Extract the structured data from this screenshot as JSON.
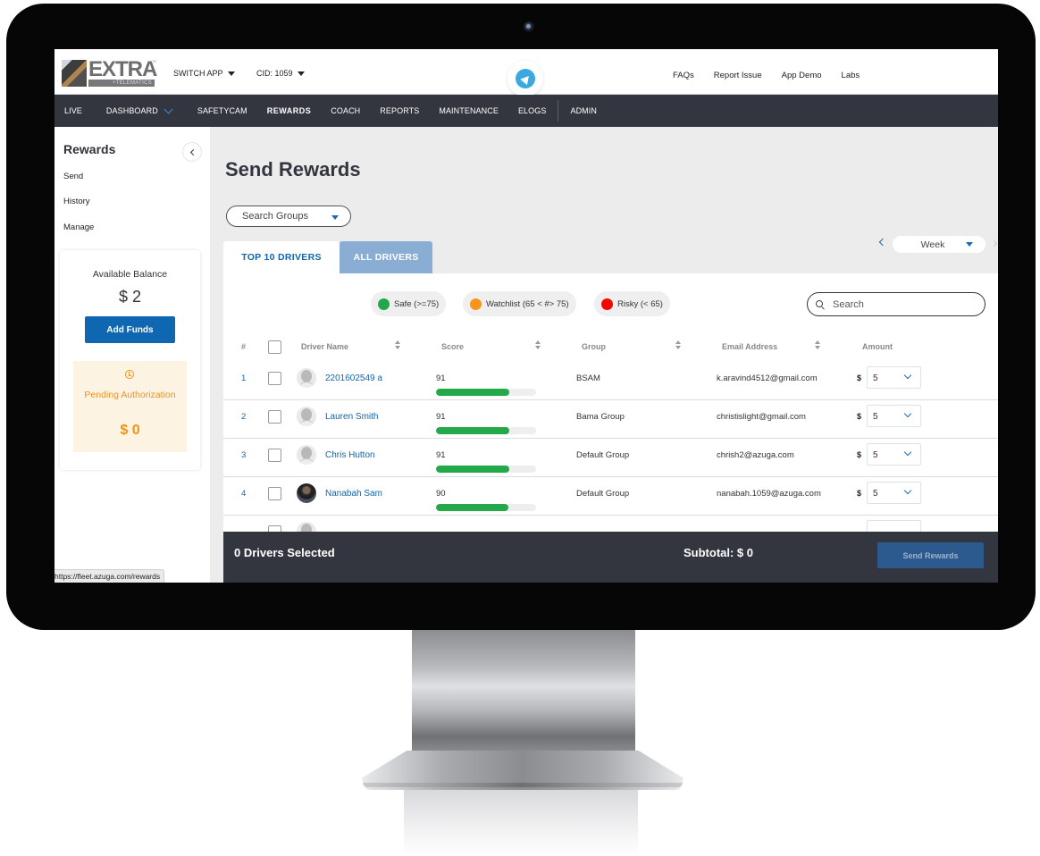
{
  "header": {
    "logo_word": "EXTRA",
    "logo_sub": "+TELEMATICS",
    "logo_tm": "™",
    "switch_app": "SWITCH APP",
    "cid": "CID: 1059",
    "links": [
      "FAQs",
      "Report Issue",
      "App Demo",
      "Labs"
    ]
  },
  "nav": {
    "items": [
      {
        "label": "LIVE"
      },
      {
        "label": "DASHBOARD"
      },
      {
        "label": "SAFETYCAM"
      },
      {
        "label": "REWARDS"
      },
      {
        "label": "COACH"
      },
      {
        "label": "REPORTS"
      },
      {
        "label": "MAINTENANCE"
      },
      {
        "label": "ELOGS"
      },
      {
        "label": "ADMIN"
      }
    ],
    "active": "REWARDS"
  },
  "sidebar": {
    "title": "Rewards",
    "links": [
      "Send",
      "History",
      "Manage"
    ],
    "balance": {
      "label": "Available Balance",
      "value": "$ 2",
      "add_funds": "Add Funds"
    },
    "pending": {
      "label": "Pending Authorization",
      "value": "$ 0"
    },
    "status_url": "https://fleet.azuga.com/rewards"
  },
  "main": {
    "title": "Send Rewards",
    "group_select": "Search Groups",
    "tabs": [
      {
        "label": "TOP 10 DRIVERS",
        "active": true
      },
      {
        "label": "ALL DRIVERS",
        "active": false
      }
    ],
    "period": "Week",
    "legend": [
      {
        "label": "Safe (>=75)",
        "color": "#20a84a"
      },
      {
        "label": "Watchlist (65 < #> 75)",
        "color": "#f7941d"
      },
      {
        "label": "Risky (< 65)",
        "color": "#ff0000"
      }
    ],
    "search_placeholder": "Search",
    "columns": {
      "rank": "#",
      "driver": "Driver Name",
      "score": "Score",
      "group": "Group",
      "email": "Email Address",
      "amount": "Amount"
    },
    "currency": "$",
    "rows": [
      {
        "rank": "1",
        "name": "2201602549 a",
        "score": "91",
        "score_pct": 73,
        "group": "BSAM",
        "email": "k.aravind4512@gmail.com",
        "amount": "5",
        "photo": false
      },
      {
        "rank": "2",
        "name": "Lauren Smith",
        "score": "91",
        "score_pct": 73,
        "group": "Bama Group",
        "email": "christislight@gmail.com",
        "amount": "5",
        "photo": false
      },
      {
        "rank": "3",
        "name": "Chris Hutton",
        "score": "91",
        "score_pct": 73,
        "group": "Default Group",
        "email": "chrish2@azuga.com",
        "amount": "5",
        "photo": false
      },
      {
        "rank": "4",
        "name": "Nanabah Sam",
        "score": "90",
        "score_pct": 72,
        "group": "Default Group",
        "email": "nanabah.1059@azuga.com",
        "amount": "5",
        "photo": true
      }
    ],
    "footer": {
      "selected": "0 Drivers Selected",
      "subtotal": "Subtotal: $ 0",
      "send": "Send Rewards"
    }
  },
  "colors": {
    "brand_blue": "#0f67b1",
    "nav_dark": "#33363f",
    "safe_green": "#23a84a",
    "pending_orange": "#f0921b"
  }
}
